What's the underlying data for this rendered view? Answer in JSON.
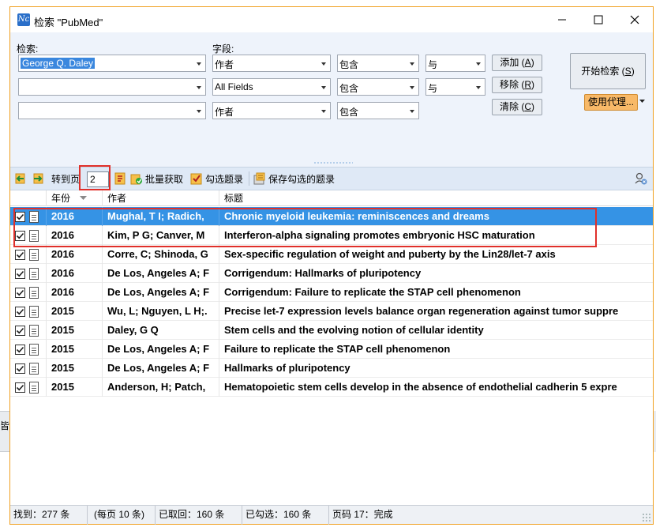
{
  "window": {
    "title": "检索 \"PubMed\"",
    "app_icon_text": "Nc"
  },
  "search": {
    "search_label": "检索:",
    "field_label": "字段:",
    "rows": [
      {
        "term": "George Q. Daley",
        "field": "作者",
        "op": "包含",
        "conj": "与"
      },
      {
        "term": "",
        "field": "All Fields",
        "op": "包含",
        "conj": "与"
      },
      {
        "term": "",
        "field": "作者",
        "op": "包含",
        "conj": ""
      }
    ],
    "add_label": "添加",
    "add_key": "A",
    "remove_label": "移除",
    "remove_key": "R",
    "clear_label": "清除",
    "clear_key": "C",
    "start_label": "开始检索",
    "start_key": "S",
    "proxy_label": "使用代理..."
  },
  "toolbar": {
    "goto_label": "转到页",
    "page_value": "2",
    "batch_label": "批量获取",
    "check_label": "勾选题录",
    "save_label": "保存勾选的题录"
  },
  "grid": {
    "headers": {
      "year": "年份",
      "author": "作者",
      "title": "标题"
    },
    "rows": [
      {
        "year": "2016",
        "author": "Mughal, T I; Radich,",
        "title": "Chronic myeloid leukemia: reminiscences and dreams"
      },
      {
        "year": "2016",
        "author": "Kim, P G; Canver, M",
        "title": "Interferon-alpha signaling promotes embryonic HSC maturation"
      },
      {
        "year": "2016",
        "author": "Corre, C; Shinoda, G",
        "title": "Sex-specific regulation of weight and puberty by the Lin28/let-7 axis"
      },
      {
        "year": "2016",
        "author": "De Los, Angeles A; F",
        "title": "Corrigendum: Hallmarks of pluripotency"
      },
      {
        "year": "2016",
        "author": "De Los, Angeles A; F",
        "title": "Corrigendum: Failure to replicate the STAP cell phenomenon"
      },
      {
        "year": "2015",
        "author": "Wu, L; Nguyen, L H;.",
        "title": "Precise let-7 expression levels balance organ regeneration against tumor suppre"
      },
      {
        "year": "2015",
        "author": "Daley, G Q",
        "title": "Stem cells and the evolving notion of cellular identity"
      },
      {
        "year": "2015",
        "author": "De Los, Angeles A; F",
        "title": "Failure to replicate the STAP cell phenomenon"
      },
      {
        "year": "2015",
        "author": "De Los, Angeles A; F",
        "title": "Hallmarks of pluripotency"
      },
      {
        "year": "2015",
        "author": "Anderson, H; Patch,",
        "title": "Hematopoietic stem cells develop in the absence of endothelial cadherin 5 expre"
      }
    ]
  },
  "status": {
    "found": "找到：277 条",
    "per_page": "(每页 10 条)",
    "fetched": "已取回：160 条",
    "checked": "已勾选：160 条",
    "page_state": "页码 17：完成"
  },
  "background": {
    "left_text": "皆"
  },
  "colors": {
    "accent": "#3593e5",
    "highlight_box": "#e0302a",
    "window_border": "#f0a020",
    "proxy_button": "#f8b968"
  }
}
